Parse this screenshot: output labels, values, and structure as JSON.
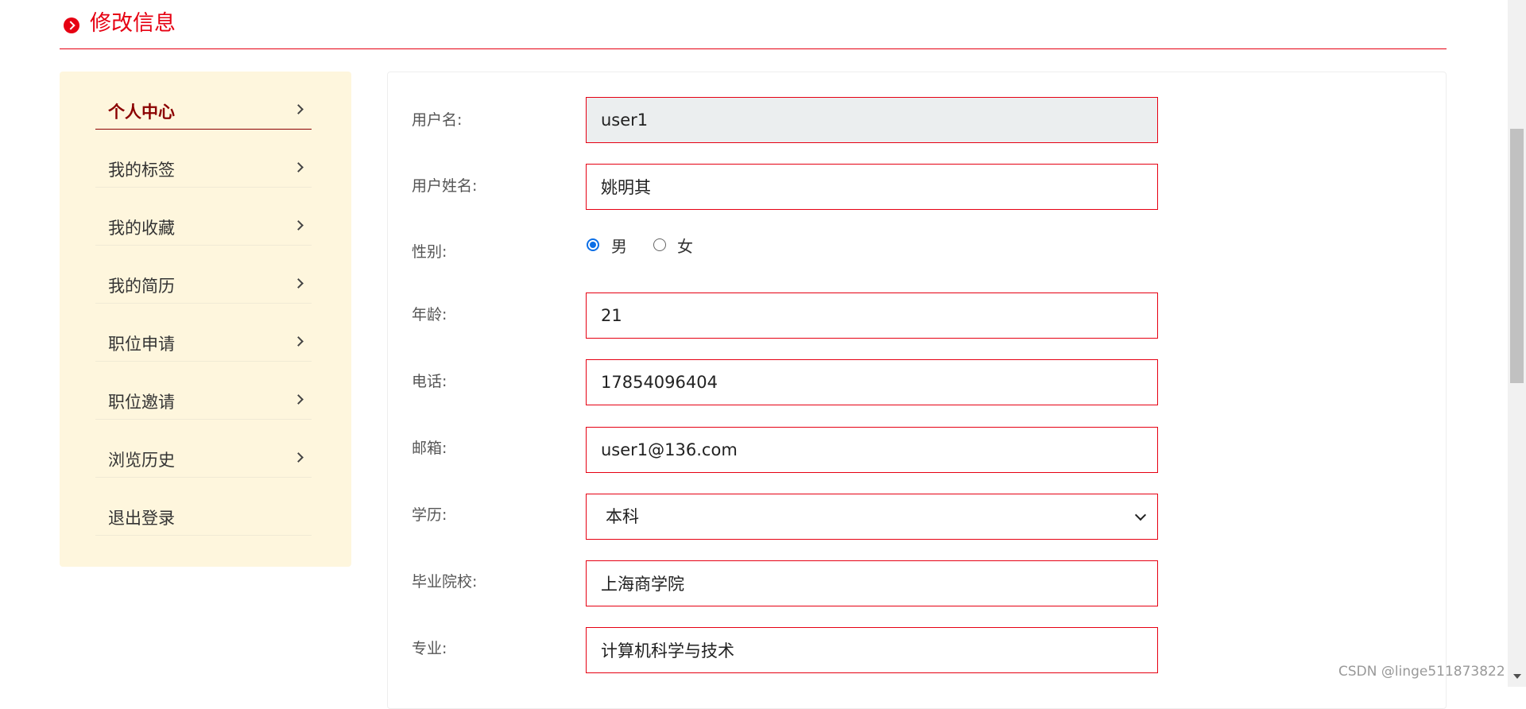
{
  "header": {
    "title": "修改信息",
    "icon": "circle-arrow-right-icon"
  },
  "sidebar": {
    "items": [
      {
        "label": "个人中心",
        "active": true,
        "has_chevron": true
      },
      {
        "label": "我的标签",
        "active": false,
        "has_chevron": true
      },
      {
        "label": "我的收藏",
        "active": false,
        "has_chevron": true
      },
      {
        "label": "我的简历",
        "active": false,
        "has_chevron": true
      },
      {
        "label": "职位申请",
        "active": false,
        "has_chevron": true
      },
      {
        "label": "职位邀请",
        "active": false,
        "has_chevron": true
      },
      {
        "label": "浏览历史",
        "active": false,
        "has_chevron": true
      },
      {
        "label": "退出登录",
        "active": false,
        "has_chevron": false
      }
    ]
  },
  "form": {
    "username": {
      "label": "用户名:",
      "value": "user1",
      "readonly": true
    },
    "fullname": {
      "label": "用户姓名:",
      "value": "姚明其"
    },
    "gender": {
      "label": "性别:",
      "options": [
        "男",
        "女"
      ],
      "selected": "男"
    },
    "age": {
      "label": "年龄:",
      "value": "21"
    },
    "phone": {
      "label": "电话:",
      "value": "17854096404"
    },
    "email": {
      "label": "邮箱:",
      "value": "user1@136.com"
    },
    "education": {
      "label": "学历:",
      "value": "本科"
    },
    "school": {
      "label": "毕业院校:",
      "value": "上海商学院"
    },
    "major": {
      "label": "专业:",
      "value": "计算机科学与技术"
    }
  },
  "watermark": "CSDN @linge511873822",
  "colors": {
    "accent": "#e60012",
    "sidebar_bg": "#fef6dd",
    "active_nav": "#8b0000",
    "radio": "#0b6ee6"
  }
}
